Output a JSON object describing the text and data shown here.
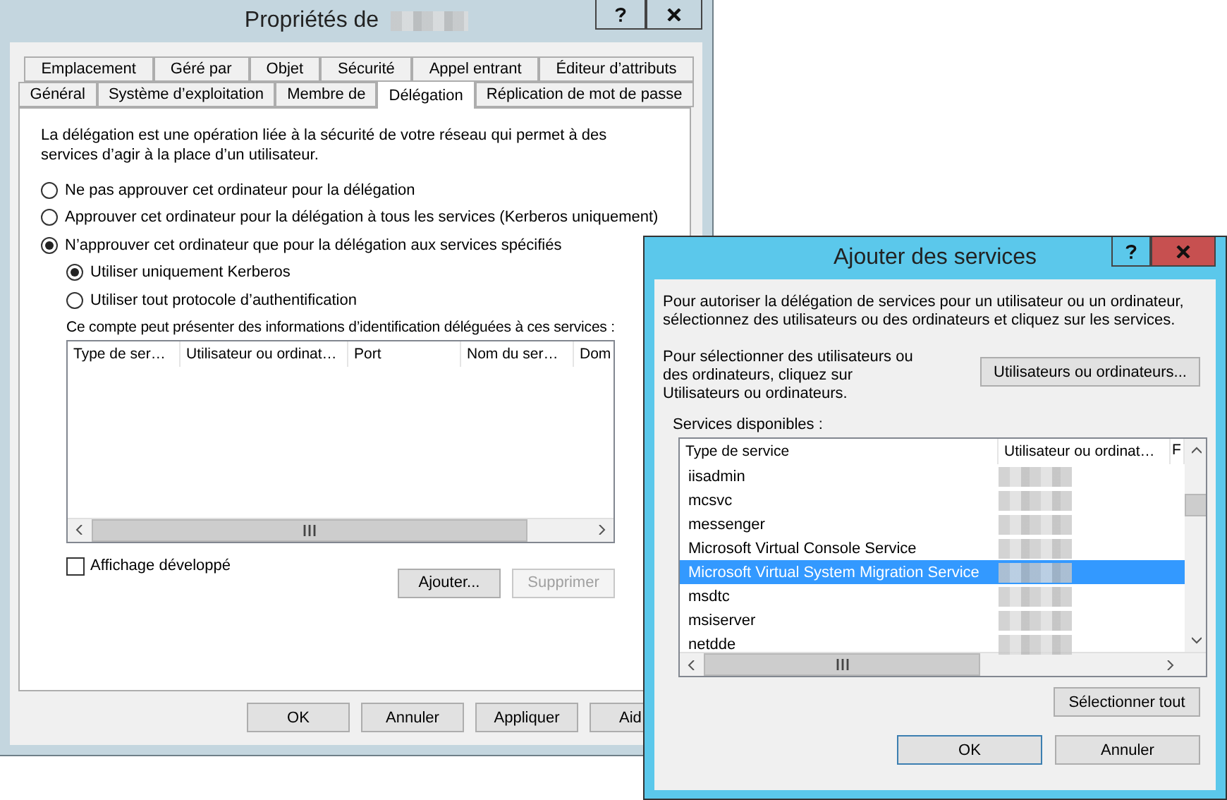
{
  "main_window": {
    "title": "Propriétés de",
    "tab_rows": [
      [
        {
          "label": "Emplacement",
          "selected": false
        },
        {
          "label": "Géré par",
          "selected": false
        },
        {
          "label": "Objet",
          "selected": false
        },
        {
          "label": "Sécurité",
          "selected": false
        },
        {
          "label": "Appel entrant",
          "selected": false
        },
        {
          "label": "Éditeur d’attributs",
          "selected": false
        }
      ],
      [
        {
          "label": "Général",
          "selected": false
        },
        {
          "label": "Système d’exploitation",
          "selected": false
        },
        {
          "label": "Membre de",
          "selected": false
        },
        {
          "label": "Délégation",
          "selected": true
        },
        {
          "label": "Réplication de mot de passe",
          "selected": false
        }
      ]
    ],
    "description": "La délégation est une opération liée à la sécurité de votre réseau qui permet à des services d’agir à la place d’un utilisateur.",
    "delegation_options": [
      {
        "label": "Ne pas approuver cet ordinateur pour la délégation",
        "selected": false
      },
      {
        "label": "Approuver cet ordinateur pour la délégation à tous les services (Kerberos uniquement)",
        "selected": false
      },
      {
        "label": "N’approuver cet ordinateur que pour la délégation aux services spécifiés",
        "selected": true
      }
    ],
    "protocol_options": [
      {
        "label": "Utiliser uniquement Kerberos",
        "selected": true
      },
      {
        "label": "Utiliser tout protocole d’authentification",
        "selected": false
      }
    ],
    "list_caption": "Ce compte peut présenter des informations d’identification déléguées à ces services :",
    "delegated_columns": [
      "Type de ser…",
      "Utilisateur ou ordinat…",
      "Port",
      "Nom du ser…",
      "Dom"
    ],
    "expanded_view": {
      "label": "Affichage développé",
      "checked": false
    },
    "list_buttons": [
      {
        "label": "Ajouter...",
        "disabled": false
      },
      {
        "label": "Supprimer",
        "disabled": true
      }
    ],
    "buttons": [
      "OK",
      "Annuler",
      "Appliquer",
      "Aid"
    ]
  },
  "add_services_dialog": {
    "title": "Ajouter des services",
    "intro": "Pour autoriser la délégation de services pour un utilisateur ou un ordinateur, sélectionnez des utilisateurs ou des ordinateurs et cliquez sur les services.",
    "select_hint": "Pour sélectionner des utilisateurs ou des ordinateurs, cliquez sur Utilisateurs ou ordinateurs.",
    "users_button": "Utilisateurs ou ordinateurs...",
    "services_label": "Services disponibles :",
    "columns": [
      "Type de service",
      "Utilisateur ou ordinat…",
      "F"
    ],
    "rows": [
      {
        "service": "iisadmin",
        "selected": false
      },
      {
        "service": "mcsvc",
        "selected": false
      },
      {
        "service": "messenger",
        "selected": false
      },
      {
        "service": "Microsoft Virtual Console Service",
        "selected": false
      },
      {
        "service": "Microsoft Virtual System Migration Service",
        "selected": true
      },
      {
        "service": "msdtc",
        "selected": false
      },
      {
        "service": "msiserver",
        "selected": false
      },
      {
        "service": "netdde",
        "selected": false
      }
    ],
    "select_all_button": "Sélectionner tout",
    "buttons": [
      "OK",
      "Annuler"
    ]
  }
}
